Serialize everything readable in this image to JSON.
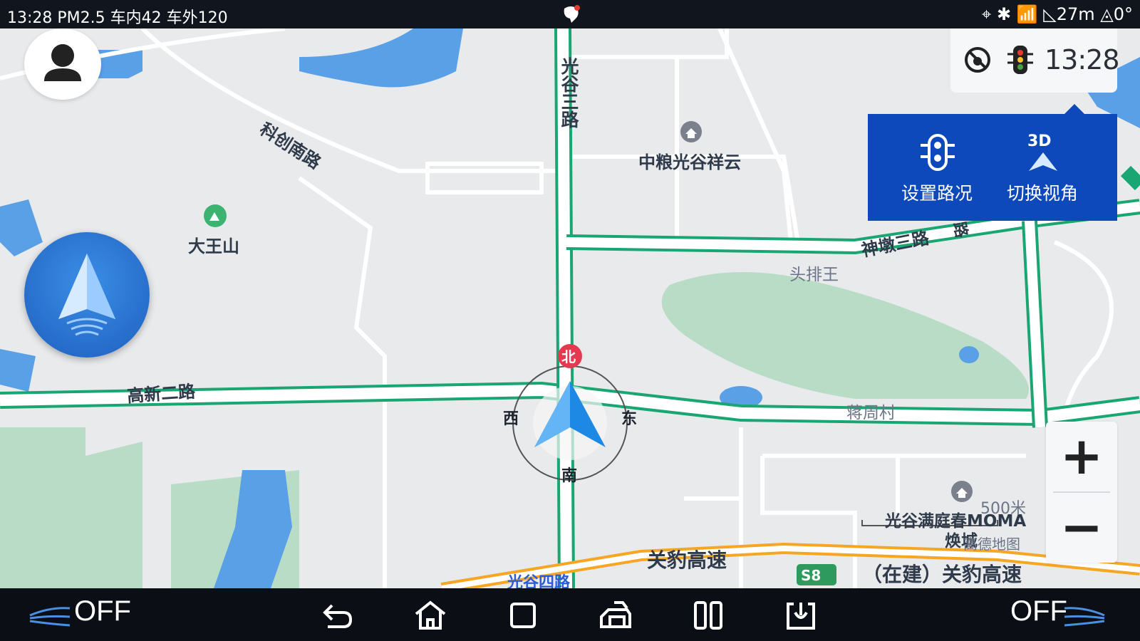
{
  "status_bar": {
    "left_text": "13:28 PM2.5 车内42 车外120",
    "right_text": "27m",
    "right_temp": "0°"
  },
  "map": {
    "roads": [
      {
        "name": "光谷三路"
      },
      {
        "name": "科创南路"
      },
      {
        "name": "高新二路"
      },
      {
        "name": "神墩三路"
      },
      {
        "name": "关豹高速"
      },
      {
        "name": "（在建）关豹高速"
      },
      {
        "name": "光谷四路"
      }
    ],
    "pois": [
      {
        "name": "中粮光谷祥云"
      },
      {
        "name": "大王山"
      },
      {
        "name": "头排王"
      },
      {
        "name": "蒋周村"
      },
      {
        "name": "光谷满庭春MOMA"
      },
      {
        "name": "焕城"
      }
    ],
    "highway_shield": "S8",
    "scale_text": "500米",
    "watermark": "高德地图",
    "compass": {
      "north": "北",
      "south": "南",
      "east": "东",
      "west": "西"
    }
  },
  "clock_panel": {
    "time": "13:28"
  },
  "quick_panel": {
    "traffic_label": "设置路况",
    "view_label": "切换视角",
    "view_badge": "3D"
  },
  "zoom": {
    "in": "+",
    "out": "−"
  },
  "bottom_bar": {
    "left_status": "OFF",
    "right_status": "OFF"
  },
  "colors": {
    "map_bg": "#e9eaec",
    "road_green": "#1aa672",
    "highway_orange": "#f5a623",
    "panel_blue": "#0d49bb",
    "water": "#5aa0e6",
    "park": "#b9dcc6"
  }
}
